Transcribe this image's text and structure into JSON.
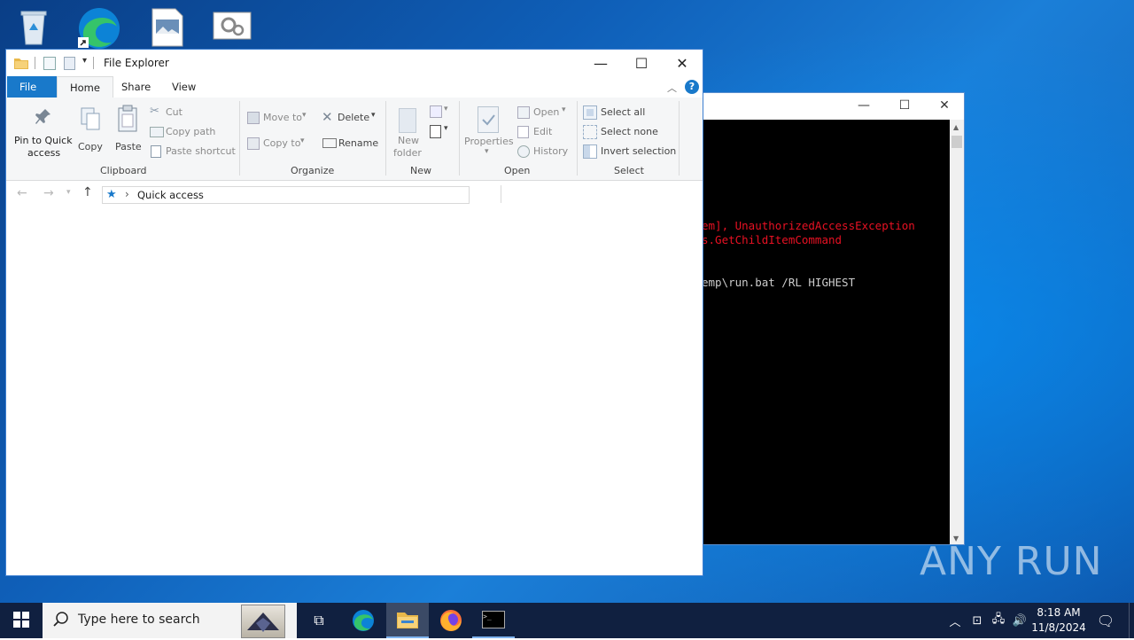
{
  "explorer": {
    "title": "File Explorer",
    "tabs": [
      "File",
      "Home",
      "Share",
      "View"
    ],
    "ribbon": {
      "clipboard": {
        "pin_label_1": "Pin to Quick",
        "pin_label_2": "access",
        "copy": "Copy",
        "paste": "Paste",
        "cut": "Cut",
        "copy_path": "Copy path",
        "paste_shortcut": "Paste shortcut",
        "group": "Clipboard"
      },
      "organize": {
        "move_to": "Move to",
        "copy_to": "Copy to",
        "delete": "Delete",
        "rename": "Rename",
        "group": "Organize"
      },
      "new": {
        "new_folder_1": "New",
        "new_folder_2": "folder",
        "group": "New"
      },
      "open": {
        "properties": "Properties",
        "open": "Open",
        "edit": "Edit",
        "history": "History",
        "group": "Open"
      },
      "select": {
        "select_all": "Select all",
        "select_none": "Select none",
        "invert": "Invert selection",
        "group": "Select"
      }
    },
    "address": {
      "separator": "›",
      "location": "Quick access"
    }
  },
  "console": {
    "lines": [
      {
        "text": "em], UnauthorizedAccessException",
        "color": "#e81123"
      },
      {
        "text": "s.GetChildItemCommand",
        "color": "#e81123"
      },
      {
        "text": "emp\\run.bat /RL HIGHEST",
        "color": "#cccccc"
      }
    ]
  },
  "taskbar": {
    "search_placeholder": "Type here to search",
    "time": "8:18 AM",
    "date": "11/8/2024"
  },
  "watermark": "ANY RUN",
  "colors": {
    "accent": "#1979ca",
    "console_error": "#e81123",
    "taskbar": "#102040"
  }
}
